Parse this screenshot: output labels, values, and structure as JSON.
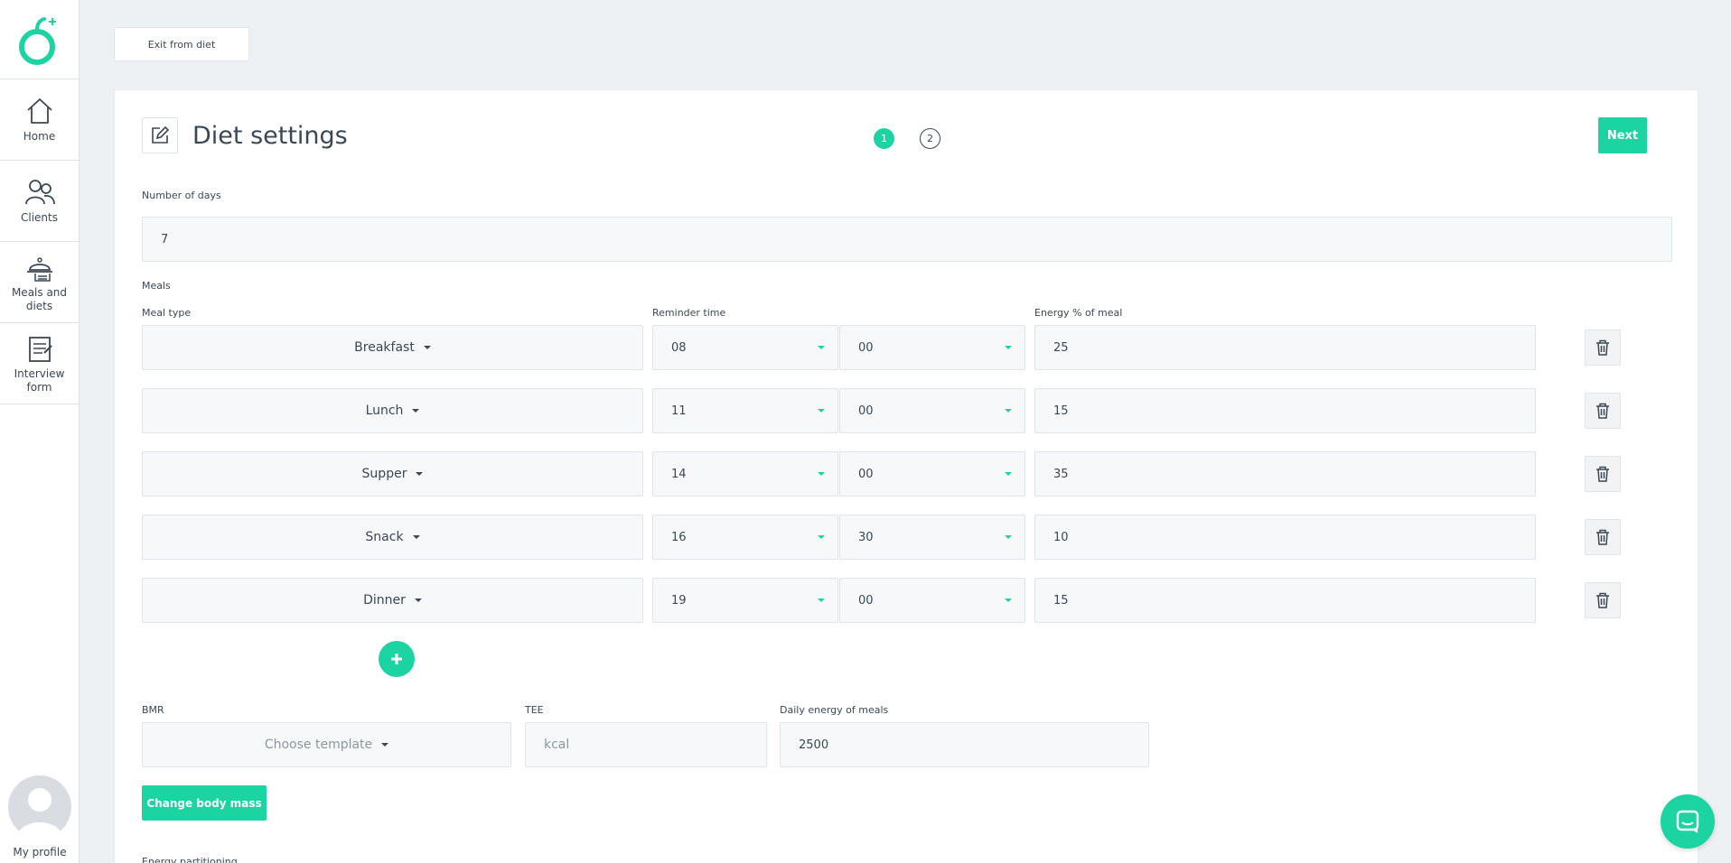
{
  "sidebar": {
    "items": [
      {
        "label": "Home",
        "icon": "home-icon"
      },
      {
        "label": "Clients",
        "icon": "users-icon"
      },
      {
        "label": "Meals and diets",
        "icon": "meals-icon"
      },
      {
        "label": "Interview form",
        "icon": "clipboard-icon"
      }
    ],
    "profile_label": "My profile"
  },
  "top": {
    "exit_label": "Exit from diet"
  },
  "card": {
    "title": "Diet settings",
    "steps": [
      "1",
      "2"
    ],
    "active_step": "1",
    "next_label": "Next"
  },
  "days": {
    "label": "Number of days",
    "value": "7"
  },
  "meals": {
    "section_label": "Meals",
    "col_type": "Meal type",
    "col_reminder": "Reminder time",
    "col_energy": "Energy % of meal",
    "rows": [
      {
        "type": "Breakfast",
        "hour": "08",
        "minute": "00",
        "energy": "25"
      },
      {
        "type": "Lunch",
        "hour": "11",
        "minute": "00",
        "energy": "15"
      },
      {
        "type": "Supper",
        "hour": "14",
        "minute": "00",
        "energy": "35"
      },
      {
        "type": "Snack",
        "hour": "16",
        "minute": "30",
        "energy": "10"
      },
      {
        "type": "Dinner",
        "hour": "19",
        "minute": "00",
        "energy": "15"
      }
    ]
  },
  "energy": {
    "bmr_label": "BMR",
    "bmr_placeholder": "Choose template",
    "tee_label": "TEE",
    "tee_placeholder": "kcal",
    "daily_label": "Daily energy of meals",
    "daily_value": "2500",
    "change_mass_label": "Change body mass",
    "partition_label": "Energy partitioning"
  },
  "colors": {
    "accent": "#1cd3a2",
    "text": "#3b4754",
    "background": "#eef1f4"
  }
}
